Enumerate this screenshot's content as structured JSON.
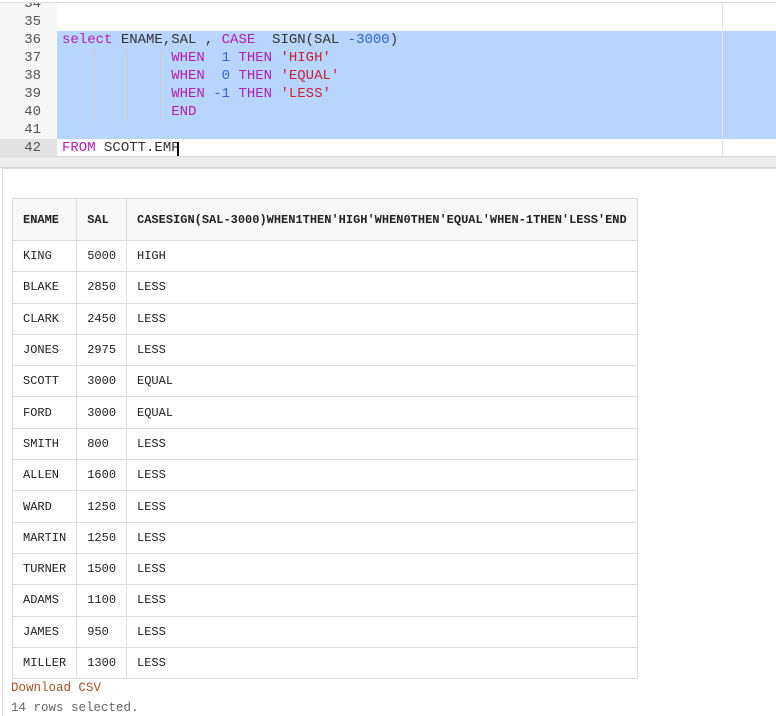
{
  "editor": {
    "line_numbers": [
      "34",
      "35",
      "36",
      "37",
      "38",
      "39",
      "40",
      "41",
      "42"
    ],
    "code_lines": [
      [],
      [],
      [
        [
          "k",
          "select"
        ],
        [
          "p",
          " ENAME,SAL , "
        ],
        [
          "k",
          "CASE"
        ],
        [
          "p",
          "  SIGN(SAL "
        ],
        [
          "n",
          "-3000"
        ],
        [
          "p",
          ")"
        ]
      ],
      [
        [
          "p",
          "             "
        ],
        [
          "k",
          "WHEN"
        ],
        [
          "p",
          "  "
        ],
        [
          "n",
          "1"
        ],
        [
          "p",
          " "
        ],
        [
          "k",
          "THEN"
        ],
        [
          "p",
          " "
        ],
        [
          "s",
          "'HIGH'"
        ]
      ],
      [
        [
          "p",
          "             "
        ],
        [
          "k",
          "WHEN"
        ],
        [
          "p",
          "  "
        ],
        [
          "n",
          "0"
        ],
        [
          "p",
          " "
        ],
        [
          "k",
          "THEN"
        ],
        [
          "p",
          " "
        ],
        [
          "s",
          "'EQUAL'"
        ]
      ],
      [
        [
          "p",
          "             "
        ],
        [
          "k",
          "WHEN"
        ],
        [
          "p",
          " "
        ],
        [
          "n",
          "-1"
        ],
        [
          "p",
          " "
        ],
        [
          "k",
          "THEN"
        ],
        [
          "p",
          " "
        ],
        [
          "s",
          "'LESS'"
        ]
      ],
      [
        [
          "p",
          "             "
        ],
        [
          "k",
          "END"
        ]
      ],
      [],
      [
        [
          "k",
          "FROM"
        ],
        [
          "p",
          " SCOTT.EMP"
        ]
      ]
    ]
  },
  "results": {
    "columns": [
      "ENAME",
      "SAL",
      "CASESIGN(SAL-3000)WHEN1THEN'HIGH'WHEN0THEN'EQUAL'WHEN-1THEN'LESS'END"
    ],
    "rows": [
      [
        "KING",
        "5000",
        "HIGH"
      ],
      [
        "BLAKE",
        "2850",
        "LESS"
      ],
      [
        "CLARK",
        "2450",
        "LESS"
      ],
      [
        "JONES",
        "2975",
        "LESS"
      ],
      [
        "SCOTT",
        "3000",
        "EQUAL"
      ],
      [
        "FORD",
        "3000",
        "EQUAL"
      ],
      [
        "SMITH",
        "800",
        "LESS"
      ],
      [
        "ALLEN",
        "1600",
        "LESS"
      ],
      [
        "WARD",
        "1250",
        "LESS"
      ],
      [
        "MARTIN",
        "1250",
        "LESS"
      ],
      [
        "TURNER",
        "1500",
        "LESS"
      ],
      [
        "ADAMS",
        "1100",
        "LESS"
      ],
      [
        "JAMES",
        "950",
        "LESS"
      ],
      [
        "MILLER",
        "1300",
        "LESS"
      ]
    ],
    "download_label": "Download CSV",
    "status": "14 rows selected."
  }
}
